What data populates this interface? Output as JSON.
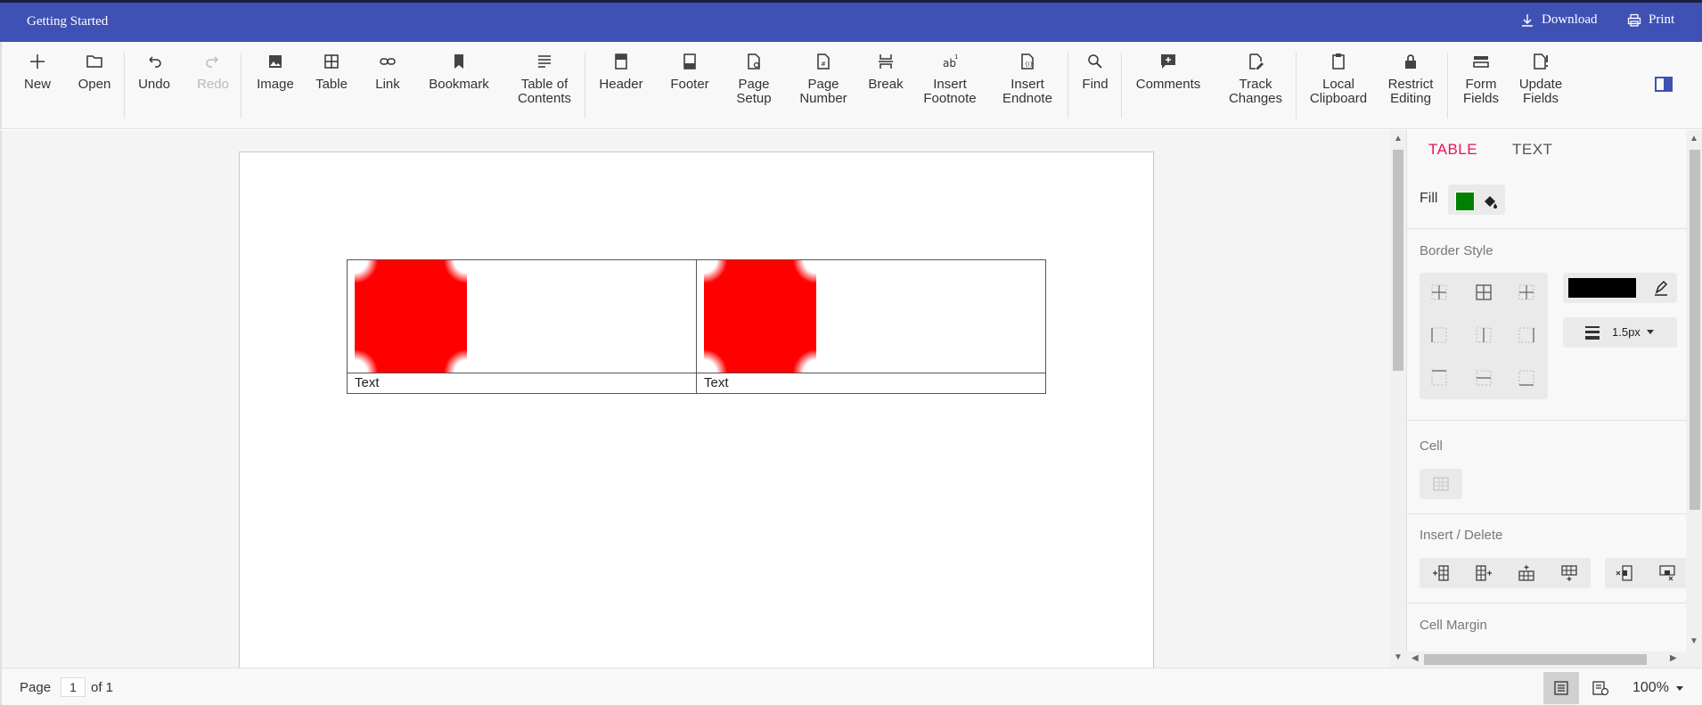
{
  "titlebar": {
    "title": "Getting Started",
    "download": "Download",
    "print": "Print"
  },
  "toolbar": {
    "new": "New",
    "open": "Open",
    "undo": "Undo",
    "redo": "Redo",
    "image": "Image",
    "table": "Table",
    "link": "Link",
    "bookmark": "Bookmark",
    "toc": [
      "Table of",
      "Contents"
    ],
    "header": "Header",
    "footer": "Footer",
    "page_setup": [
      "Page",
      "Setup"
    ],
    "page_number": [
      "Page",
      "Number"
    ],
    "break": "Break",
    "insert_footnote": [
      "Insert",
      "Footnote"
    ],
    "insert_endnote": [
      "Insert",
      "Endnote"
    ],
    "find": "Find",
    "comments": "Comments",
    "track_changes": [
      "Track",
      "Changes"
    ],
    "local_clipboard": [
      "Local",
      "Clipboard"
    ],
    "restrict_editing": [
      "Restrict",
      "Editing"
    ],
    "form_fields": [
      "Form",
      "Fields"
    ],
    "update_fields": [
      "Update",
      "Fields"
    ]
  },
  "document": {
    "cells": [
      "Text",
      "Text"
    ]
  },
  "panel": {
    "tab_table": "TABLE",
    "tab_text": "TEXT",
    "fill_label": "Fill",
    "fill_color": "#008000",
    "border_style": "Border Style",
    "border_color": "#000000",
    "border_width": "1.5px",
    "cell": "Cell",
    "insert_delete": "Insert / Delete",
    "cell_margin": "Cell Margin"
  },
  "status": {
    "page_label": "Page",
    "page_current": "1",
    "page_of": "of 1",
    "zoom": "100%"
  },
  "colors": {
    "accent": "#3f51b5",
    "tab_active": "#e3165b",
    "image_fill": "#ff0000"
  }
}
